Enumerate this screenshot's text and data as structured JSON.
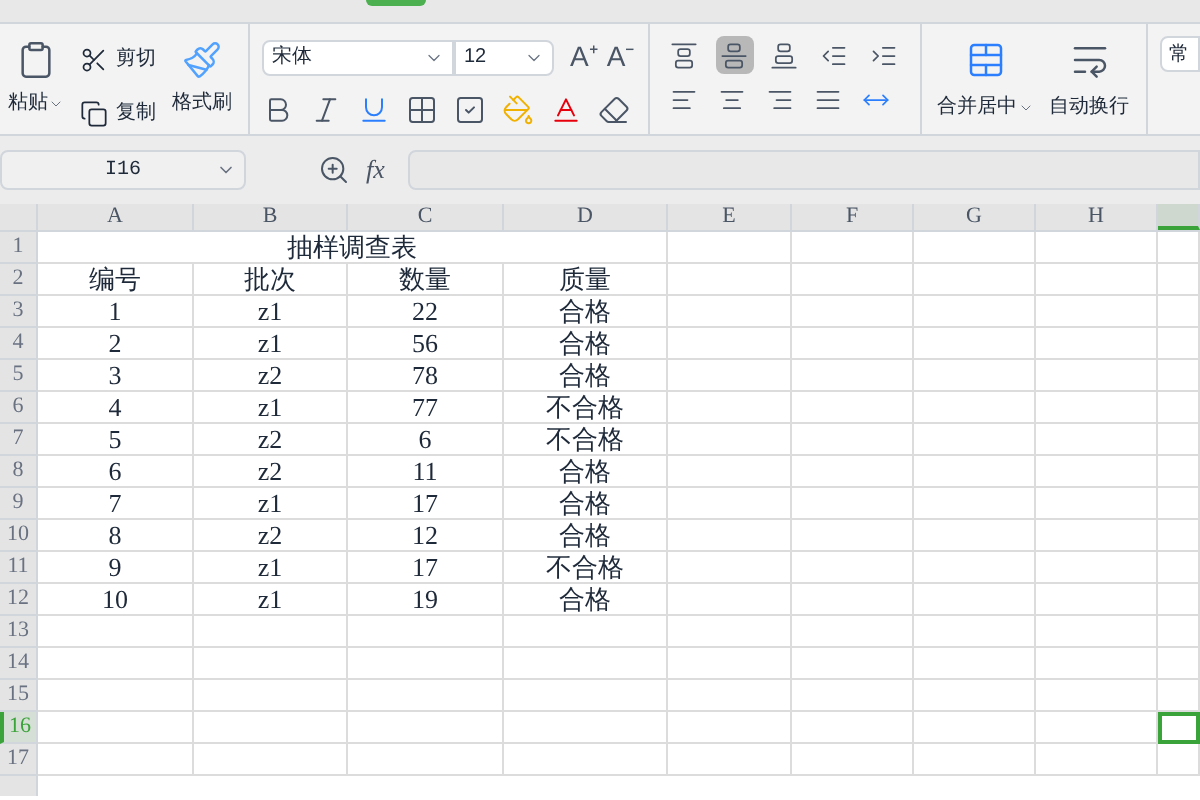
{
  "ribbon": {
    "clipboard": {
      "paste": "粘贴",
      "cut": "剪切",
      "copy": "复制",
      "format_painter": "格式刷"
    },
    "font": {
      "name": "宋体",
      "size": "12",
      "grow": "A⁺",
      "shrink": "A⁻"
    },
    "align_top_row": [
      {
        "kind": "top",
        "selected": false
      },
      {
        "kind": "middle",
        "selected": true
      },
      {
        "kind": "bottom",
        "selected": false
      },
      {
        "kind": "outdent",
        "selected": false
      },
      {
        "kind": "indent",
        "selected": false
      }
    ],
    "merge_center": "合并居中",
    "wrap_text": "自动换行",
    "style_box": "常"
  },
  "formula_bar": {
    "name_box": "I16",
    "fx": "fx"
  },
  "columns": [
    {
      "label": "A",
      "selected": false
    },
    {
      "label": "B",
      "selected": false
    },
    {
      "label": "C",
      "selected": false
    },
    {
      "label": "D",
      "selected": false
    },
    {
      "label": "E",
      "selected": false
    },
    {
      "label": "F",
      "selected": false
    },
    {
      "label": "G",
      "selected": false
    },
    {
      "label": "H",
      "selected": false
    },
    {
      "selected": true
    }
  ],
  "title": "抽样调查表",
  "rows": [
    {
      "header": "2",
      "selected": false,
      "cells": [
        "编号",
        "批次",
        "数量",
        "质量"
      ]
    },
    {
      "header": "3",
      "selected": false,
      "cells": [
        "1",
        "z1",
        "22",
        "合格"
      ]
    },
    {
      "header": "4",
      "selected": false,
      "cells": [
        "2",
        "z1",
        "56",
        "合格"
      ]
    },
    {
      "header": "5",
      "selected": false,
      "cells": [
        "3",
        "z2",
        "78",
        "合格"
      ]
    },
    {
      "header": "6",
      "selected": false,
      "cells": [
        "4",
        "z1",
        "77",
        "不合格"
      ]
    },
    {
      "header": "7",
      "selected": false,
      "cells": [
        "5",
        "z2",
        "6",
        "不合格"
      ]
    },
    {
      "header": "8",
      "selected": false,
      "cells": [
        "6",
        "z2",
        "11",
        "合格"
      ]
    },
    {
      "header": "9",
      "selected": false,
      "cells": [
        "7",
        "z1",
        "17",
        "合格"
      ]
    },
    {
      "header": "10",
      "selected": false,
      "cells": [
        "8",
        "z2",
        "12",
        "合格"
      ]
    },
    {
      "header": "11",
      "selected": false,
      "cells": [
        "9",
        "z1",
        "17",
        "不合格"
      ]
    },
    {
      "header": "12",
      "selected": false,
      "cells": [
        "10",
        "z1",
        "19",
        "合格"
      ]
    },
    {
      "header": "13",
      "selected": false,
      "cells": []
    },
    {
      "header": "14",
      "selected": false,
      "cells": []
    },
    {
      "header": "15",
      "selected": false,
      "cells": []
    },
    {
      "header": "16",
      "selected": true,
      "cells": []
    },
    {
      "header": "17",
      "selected": false,
      "cells": []
    }
  ],
  "title_row_header": "1"
}
